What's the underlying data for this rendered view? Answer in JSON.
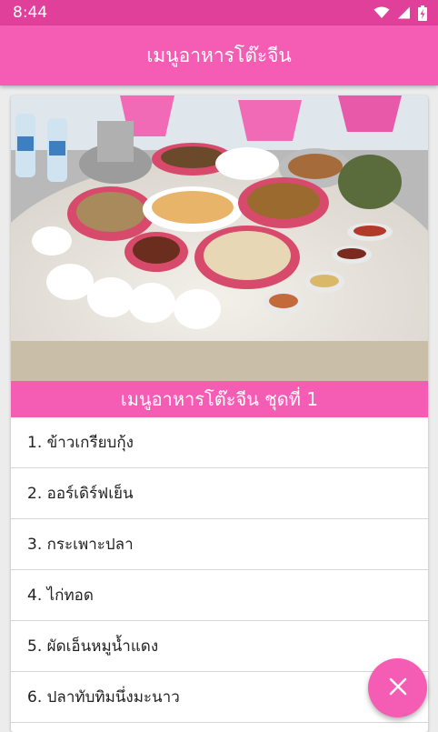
{
  "status_bar": {
    "time": "8:44",
    "icons": [
      "wifi-icon",
      "cell-signal-icon",
      "battery-charging-icon"
    ]
  },
  "app_bar": {
    "title": "เมนูอาหารโต๊ะจีน"
  },
  "card": {
    "image_icon": "photo-food-table",
    "set_title": "เมนูอาหารโต๊ะจีน ชุดที่ 1",
    "items": [
      "1. ข้าวเกรียบกุ้ง",
      "2. ออร์เดิร์ฟเย็น",
      "3. กระเพาะปลา",
      "4. ไก่ทอด",
      "5. ผัดเอ็นหมูน้ำแดง",
      "6. ปลาทับทิมนึ่งมะนาว"
    ]
  },
  "fab": {
    "icon": "close-icon"
  },
  "colors": {
    "status_bar": "#e0409a",
    "primary": "#f55db4",
    "background": "#ececec"
  }
}
